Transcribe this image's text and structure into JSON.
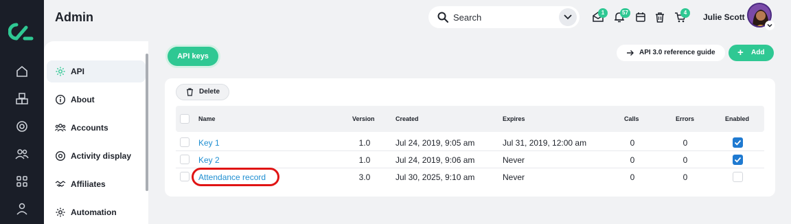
{
  "header": {
    "title": "Admin",
    "search_label": "Search",
    "notifications": {
      "mail_count": "1",
      "bell_count": "57",
      "cart_count": "4"
    },
    "user_name": "Julie Scott"
  },
  "sidebar": {
    "items": [
      {
        "label": "API",
        "icon": "gear-icon",
        "active": true
      },
      {
        "label": "About",
        "icon": "info-icon"
      },
      {
        "label": "Accounts",
        "icon": "users-icon"
      },
      {
        "label": "Activity display",
        "icon": "target-icon"
      },
      {
        "label": "Affiliates",
        "icon": "handshake-icon"
      },
      {
        "label": "Automation",
        "icon": "gear-icon"
      }
    ]
  },
  "toolbar": {
    "tab_label": "API keys",
    "ref_guide_label": "API 3.0 reference guide",
    "add_label": "Add"
  },
  "table": {
    "delete_label": "Delete",
    "columns": [
      "Name",
      "Version",
      "Created",
      "Expires",
      "Calls",
      "Errors",
      "Enabled"
    ],
    "rows": [
      {
        "name": "Key 1",
        "version": "1.0",
        "created": "Jul 24, 2019, 9:05 am",
        "expires": "Jul 31, 2019, 12:00 am",
        "calls": "0",
        "errors": "0",
        "enabled": true
      },
      {
        "name": "Key 2",
        "version": "1.0",
        "created": "Jul 24, 2019, 9:06 am",
        "expires": "Never",
        "calls": "0",
        "errors": "0",
        "enabled": true
      },
      {
        "name": "Attendance record",
        "version": "3.0",
        "created": "Jul 30, 2025, 9:10 am",
        "expires": "Never",
        "calls": "0",
        "errors": "0",
        "enabled": false
      }
    ]
  },
  "colors": {
    "accent": "#2fc893",
    "link": "#1f8ed1",
    "rail": "#1a1e28",
    "highlight": "#e01414",
    "checkbox_on": "#1f7ad1"
  }
}
